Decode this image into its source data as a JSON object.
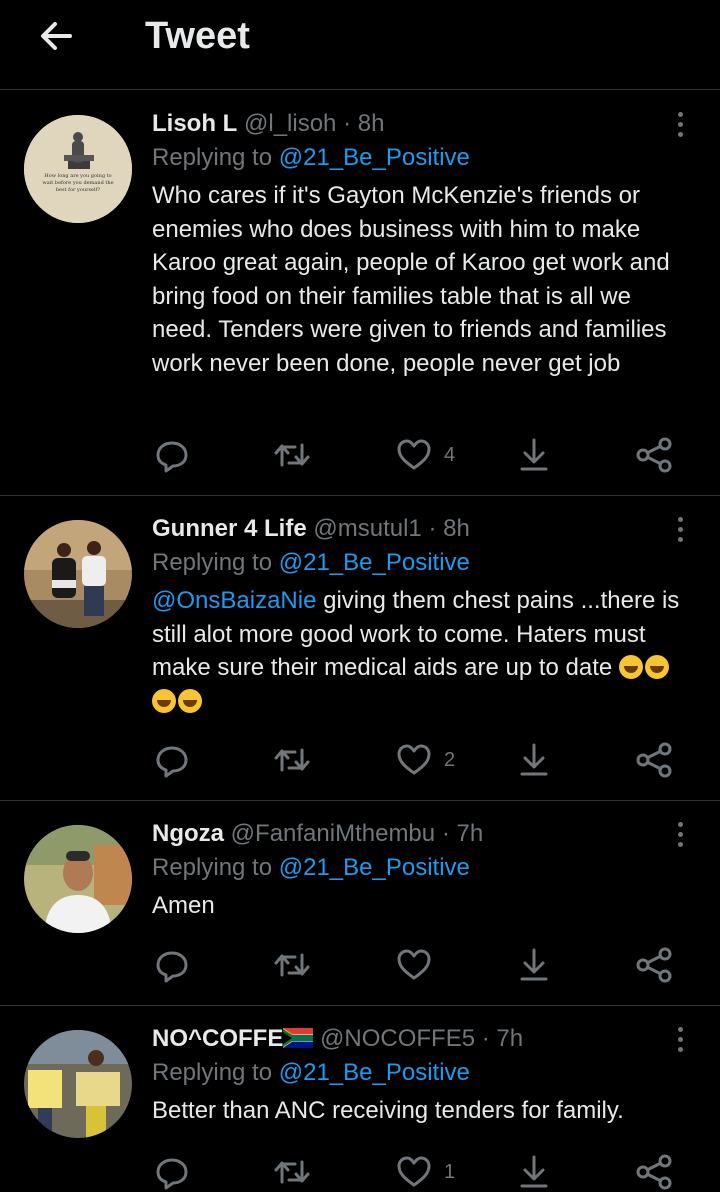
{
  "header": {
    "title": "Tweet"
  },
  "tweets": [
    {
      "name": "Lisoh L",
      "handle": "@l_lisoh",
      "time": "8h",
      "replying_label": "Replying to",
      "replying_to": "@21_Be_Positive",
      "avatar_caption": "How long are you going to wait before you demand the best for yourself?",
      "text": "Who cares if it's Gayton McKenzie's friends or enemies who does business with him to make Karoo great again, people of Karoo get work and bring food on their families table that is all we need. Tenders were given to friends and families work never been done, people never get job",
      "likes": "4"
    },
    {
      "name": "Gunner 4 Life",
      "handle": "@msutul1",
      "time": "8h",
      "replying_label": "Replying to",
      "replying_to": "@21_Be_Positive",
      "mention": "@OnsBaizaNie",
      "text": " giving them chest pains ...there is still alot more good work to come. Haters must make sure their medical aids are up to date ",
      "emoji_name": "rolling-on-floor-laughing",
      "likes": "2"
    },
    {
      "name": "Ngoza",
      "handle": "@FanfaniMthembu",
      "time": "7h",
      "replying_label": "Replying to",
      "replying_to": "@21_Be_Positive",
      "text": "Amen",
      "likes": ""
    },
    {
      "name": "NO^COFFE",
      "handle": "@NOCOFFE5",
      "time": "7h",
      "replying_label": "Replying to",
      "replying_to": "@21_Be_Positive",
      "text": "Better than ANC receiving tenders for family.",
      "likes": "1"
    }
  ],
  "icons": {
    "back": "arrow-left-icon",
    "reply": "reply-icon",
    "retweet": "retweet-icon",
    "like": "heart-icon",
    "download": "download-icon",
    "share": "share-icon",
    "more": "more-vertical-icon",
    "flag": "south-africa-flag-icon"
  },
  "colors": {
    "background": "#000000",
    "text": "#e7e9ea",
    "muted": "#71767b",
    "accent": "#1d9bf0",
    "divider": "#2f3336"
  }
}
